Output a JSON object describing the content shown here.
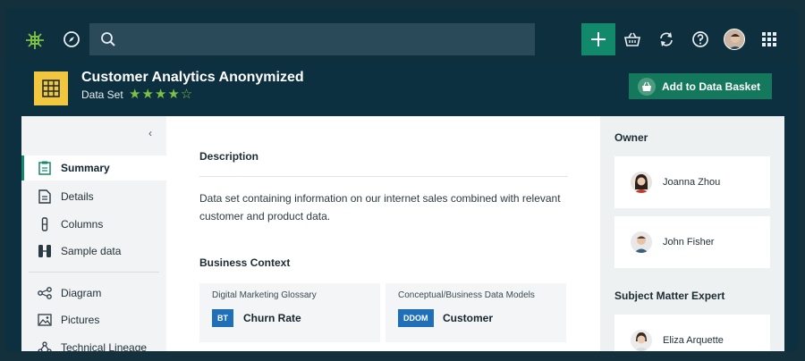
{
  "topbar": {
    "search_placeholder": "",
    "icons": [
      "app-logo-icon",
      "compass-icon",
      "search-icon",
      "plus-icon",
      "basket-icon",
      "refresh-icon",
      "help-icon",
      "avatar",
      "apps-grid-icon"
    ]
  },
  "header": {
    "title": "Customer Analytics Anonymized",
    "type": "Data Set",
    "rating": 4,
    "rating_max": 5,
    "stars": "★★★★☆",
    "add_basket_label": "Add to Data Basket"
  },
  "sidebar": {
    "collapse_glyph": "‹",
    "items": [
      {
        "label": "Summary",
        "icon": "clipboard-icon",
        "active": true
      },
      {
        "label": "Details",
        "icon": "document-icon",
        "active": false
      },
      {
        "label": "Columns",
        "icon": "columns-icon",
        "active": false
      },
      {
        "label": "Sample data",
        "icon": "sample-data-icon",
        "active": false
      },
      {
        "label": "Diagram",
        "icon": "diagram-icon",
        "active": false
      },
      {
        "label": "Pictures",
        "icon": "pictures-icon",
        "active": false
      },
      {
        "label": "Technical Lineage",
        "icon": "lineage-icon",
        "active": false
      }
    ]
  },
  "main": {
    "description_heading": "Description",
    "description_text": "Data set containing information on our internet sales combined with relevant customer and product data.",
    "business_context_heading": "Business Context",
    "cards": [
      {
        "glossary": "Digital Marketing Glossary",
        "code": "BT",
        "term": "Churn Rate"
      },
      {
        "glossary": "Conceptual/Business Data Models",
        "code": "DDOM",
        "term": "Customer"
      }
    ]
  },
  "right": {
    "owner_heading": "Owner",
    "owners": [
      {
        "name": "Joanna Zhou"
      },
      {
        "name": "John Fisher"
      }
    ],
    "sme_heading": "Subject Matter Expert",
    "smes": [
      {
        "name": "Eliza Arquette"
      }
    ]
  },
  "colors": {
    "accent": "#12896a",
    "dataset_icon": "#f3c63f",
    "star": "#7cc143",
    "code_badge": "#1f70b8"
  }
}
